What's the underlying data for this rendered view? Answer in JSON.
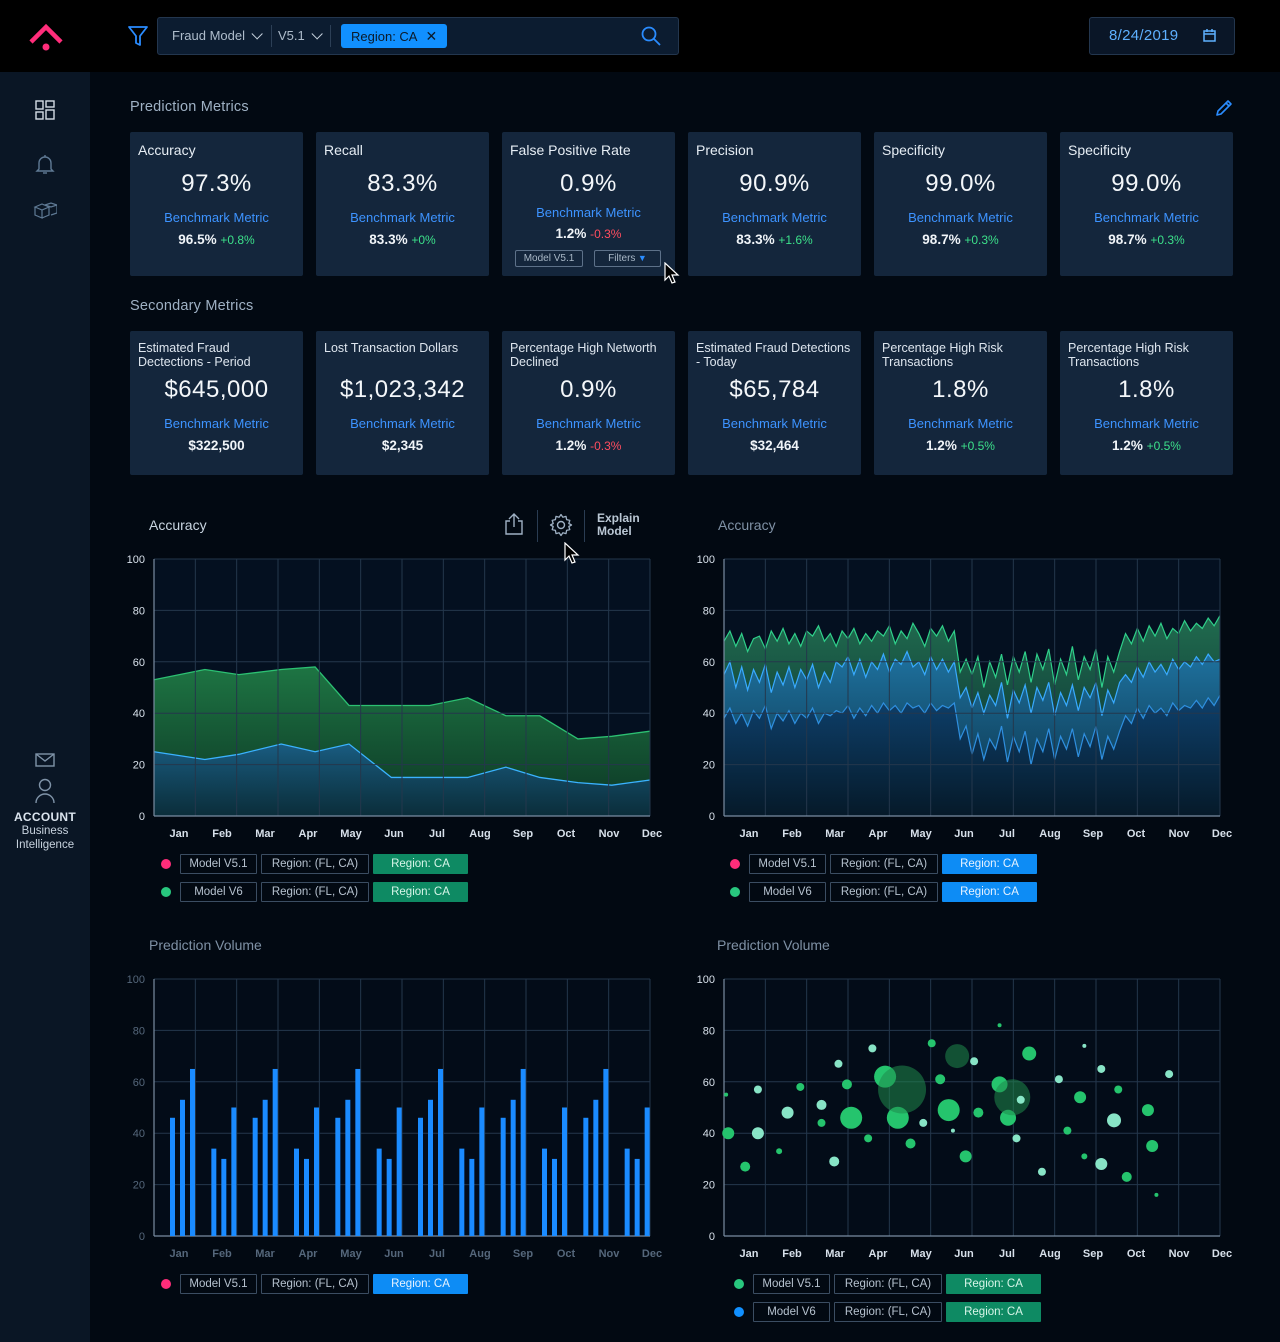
{
  "topbar": {
    "model_select": "Fraud Model",
    "version_select": "V5.1",
    "filter_chip": "Region: CA",
    "date": "8/24/2019"
  },
  "sidebar": {
    "account_label": "ACCOUNT",
    "account_sub1": "Business",
    "account_sub2": "Intelligence"
  },
  "prediction_metrics": {
    "title": "Prediction Metrics",
    "cards": [
      {
        "title": "Accuracy",
        "value": "97.3%",
        "benchmark_label": "Benchmark Metric",
        "benchmark_value": "96.5%",
        "delta": "+0.8%",
        "delta_type": "pos"
      },
      {
        "title": "Recall",
        "value": "83.3%",
        "benchmark_label": "Benchmark Metric",
        "benchmark_value": "83.3%",
        "delta": "+0%",
        "delta_type": "pos"
      },
      {
        "title": "False Positive Rate",
        "value": "0.9%",
        "benchmark_label": "Benchmark Metric",
        "benchmark_value": "1.2%",
        "delta": "-0.3%",
        "delta_type": "neg",
        "model_tag": "Model V5.1",
        "filters_label": "Filters"
      },
      {
        "title": "Precision",
        "value": "90.9%",
        "benchmark_label": "Benchmark Metric",
        "benchmark_value": "83.3%",
        "delta": "+1.6%",
        "delta_type": "pos"
      },
      {
        "title": "Specificity",
        "value": "99.0%",
        "benchmark_label": "Benchmark Metric",
        "benchmark_value": "98.7%",
        "delta": "+0.3%",
        "delta_type": "pos"
      },
      {
        "title": "Specificity",
        "value": "99.0%",
        "benchmark_label": "Benchmark Metric",
        "benchmark_value": "98.7%",
        "delta": "+0.3%",
        "delta_type": "pos"
      }
    ]
  },
  "secondary_metrics": {
    "title": "Secondary Metrics",
    "cards": [
      {
        "title": "Estimated Fraud Dectections - Period",
        "value": "$645,000",
        "benchmark_label": "Benchmark Metric",
        "benchmark_value": "$322,500",
        "delta": "",
        "delta_type": "pos"
      },
      {
        "title": "Lost Transaction Dollars",
        "value": "$1,023,342",
        "benchmark_label": "Benchmark Metric",
        "benchmark_value": "$2,345",
        "delta": "",
        "delta_type": "pos"
      },
      {
        "title": "Percentage High Networth Declined",
        "value": "0.9%",
        "benchmark_label": "Benchmark Metric",
        "benchmark_value": "1.2%",
        "delta": "-0.3%",
        "delta_type": "neg"
      },
      {
        "title": "Estimated Fraud Detections - Today",
        "value": "$65,784",
        "benchmark_label": "Benchmark Metric",
        "benchmark_value": "$32,464",
        "delta": "",
        "delta_type": "pos"
      },
      {
        "title": "Percentage High Risk Transactions",
        "value": "1.8%",
        "benchmark_label": "Benchmark Metric",
        "benchmark_value": "1.2%",
        "delta": "+0.5%",
        "delta_type": "pos"
      },
      {
        "title": "Percentage High Risk Transactions",
        "value": "1.8%",
        "benchmark_label": "Benchmark Metric",
        "benchmark_value": "1.2%",
        "delta": "+0.5%",
        "delta_type": "pos"
      }
    ]
  },
  "toolbar": {
    "explain_line1": "Explain",
    "explain_line2": "Model"
  },
  "legends": {
    "model_v51": "Model V5.1",
    "model_v6": "Model V6",
    "region_fl_ca": "Region: (FL, CA)",
    "region_ca": "Region: CA"
  },
  "colors": {
    "pink": "#ff2d7a",
    "green": "#28c77e",
    "blue": "#1190ff"
  },
  "chart_data": [
    {
      "type": "area",
      "title": "Accuracy",
      "categories": [
        "Jan",
        "Feb",
        "Mar",
        "Apr",
        "May",
        "Jun",
        "Jul",
        "Aug",
        "Sep",
        "Oct",
        "Nov",
        "Dec"
      ],
      "x": [
        0,
        1.2,
        2,
        3,
        3.8,
        4.6,
        5.6,
        6.5,
        7.4,
        8.3,
        9.1,
        10,
        10.8,
        11.7
      ],
      "ylim": [
        0,
        100
      ],
      "yticks": [
        0,
        20,
        40,
        60,
        80,
        100
      ],
      "series": [
        {
          "name": "Model V6",
          "values": [
            53,
            57,
            55,
            57,
            58,
            43,
            43,
            43,
            46,
            39,
            39,
            30,
            31,
            33
          ]
        },
        {
          "name": "Model V5.1",
          "values": [
            25,
            22,
            24,
            28,
            25,
            28,
            15,
            15,
            15,
            19,
            15,
            13,
            12,
            14
          ]
        }
      ]
    },
    {
      "type": "area",
      "title": "Accuracy",
      "categories": [
        "Jan",
        "Feb",
        "Mar",
        "Apr",
        "May",
        "Jun",
        "Jul",
        "Aug",
        "Sep",
        "Oct",
        "Nov",
        "Dec"
      ],
      "ylim": [
        0,
        100
      ],
      "yticks": [
        0,
        20,
        40,
        60,
        80,
        100
      ],
      "series": [
        {
          "name": "Model V6",
          "values": [
            68,
            72,
            66,
            71,
            64,
            69,
            70,
            65,
            72,
            68,
            73,
            67,
            71,
            66,
            72,
            70,
            74,
            68,
            71,
            66,
            72,
            69,
            73,
            67,
            71,
            68,
            72,
            70,
            74,
            67,
            72,
            69,
            75,
            71,
            66,
            73,
            70,
            74,
            68,
            72,
            56,
            61,
            55,
            62,
            50,
            60,
            54,
            63,
            51,
            62,
            56,
            64,
            52,
            63,
            57,
            65,
            51,
            61,
            55,
            66,
            53,
            62,
            57,
            65,
            50,
            62,
            56,
            64,
            71,
            67,
            73,
            68,
            74,
            70,
            75,
            69,
            73,
            71,
            76,
            72,
            75,
            73,
            77,
            74,
            78
          ]
        },
        {
          "name": "Model V5.1",
          "values": [
            55,
            60,
            50,
            58,
            49,
            57,
            52,
            59,
            48,
            56,
            51,
            58,
            50,
            57,
            53,
            59,
            50,
            56,
            52,
            60,
            58,
            62,
            55,
            61,
            54,
            60,
            57,
            63,
            56,
            61,
            59,
            64,
            58,
            60,
            55,
            62,
            57,
            61,
            56,
            60,
            46,
            50,
            42,
            48,
            40,
            47,
            43,
            52,
            38,
            49,
            44,
            51,
            40,
            50,
            45,
            52,
            39,
            48,
            43,
            51,
            41,
            50,
            46,
            52,
            39,
            49,
            44,
            52,
            55,
            52,
            58,
            54,
            60,
            56,
            59,
            55,
            61,
            57,
            60,
            58,
            62,
            59,
            63,
            60,
            61
          ]
        },
        {
          "name": "Region: CA",
          "values": [
            38,
            42,
            36,
            40,
            35,
            41,
            38,
            43,
            34,
            40,
            37,
            41,
            36,
            40,
            38,
            42,
            36,
            40,
            39,
            41,
            40,
            43,
            38,
            42,
            39,
            43,
            40,
            44,
            41,
            43,
            40,
            44,
            42,
            43,
            40,
            44,
            41,
            43,
            42,
            44,
            30,
            35,
            24,
            32,
            22,
            30,
            26,
            35,
            21,
            31,
            25,
            33,
            20,
            30,
            25,
            34,
            22,
            31,
            26,
            34,
            23,
            32,
            27,
            35,
            22,
            31,
            26,
            33,
            39,
            36,
            42,
            38,
            43,
            40,
            42,
            39,
            44,
            41,
            43,
            42,
            45,
            42,
            46,
            43,
            47
          ]
        }
      ]
    },
    {
      "type": "bar",
      "title": "Prediction Volume",
      "categories": [
        "Jan",
        "Feb",
        "Mar",
        "Apr",
        "May",
        "Jun",
        "Jul",
        "Aug",
        "Sep",
        "Oct",
        "Nov",
        "Dec"
      ],
      "ylim": [
        0,
        100
      ],
      "yticks": [
        0,
        20,
        40,
        60,
        80,
        100
      ],
      "series": [
        {
          "name": "Model V5.1",
          "values": [
            46,
            53,
            65,
            34,
            30,
            50,
            46,
            53,
            65,
            34,
            30,
            50,
            46,
            53,
            65,
            34,
            30,
            50,
            46,
            53,
            65,
            34,
            30,
            50,
            46,
            53,
            65,
            34,
            30,
            50,
            46,
            53,
            65,
            34,
            30,
            50
          ]
        }
      ]
    },
    {
      "type": "scatter",
      "title": "Prediction Volume",
      "categories": [
        "Jan",
        "Feb",
        "Mar",
        "Apr",
        "May",
        "Jun",
        "Jul",
        "Aug",
        "Sep",
        "Oct",
        "Nov",
        "Dec"
      ],
      "ylim": [
        0,
        100
      ],
      "yticks": [
        0,
        20,
        40,
        60,
        80,
        100
      ],
      "points": [
        {
          "x": 0.05,
          "y": 55,
          "r": 2,
          "c": "g"
        },
        {
          "x": 0.1,
          "y": 40,
          "r": 6,
          "c": "g"
        },
        {
          "x": 0.5,
          "y": 27,
          "r": 5,
          "c": "g"
        },
        {
          "x": 0.8,
          "y": 57,
          "r": 4,
          "c": "l"
        },
        {
          "x": 0.8,
          "y": 40,
          "r": 6,
          "c": "l"
        },
        {
          "x": 1.3,
          "y": 33,
          "r": 3,
          "c": "g"
        },
        {
          "x": 1.5,
          "y": 48,
          "r": 6,
          "c": "l"
        },
        {
          "x": 1.8,
          "y": 58,
          "r": 4,
          "c": "g"
        },
        {
          "x": 2.3,
          "y": 44,
          "r": 4,
          "c": "g"
        },
        {
          "x": 2.3,
          "y": 51,
          "r": 5,
          "c": "l"
        },
        {
          "x": 2.6,
          "y": 29,
          "r": 5,
          "c": "l"
        },
        {
          "x": 2.7,
          "y": 67,
          "r": 4,
          "c": "l"
        },
        {
          "x": 2.9,
          "y": 59,
          "r": 5,
          "c": "g"
        },
        {
          "x": 3.0,
          "y": 46,
          "r": 11,
          "c": "g"
        },
        {
          "x": 3.4,
          "y": 38,
          "r": 4,
          "c": "g"
        },
        {
          "x": 3.5,
          "y": 73,
          "r": 4,
          "c": "l"
        },
        {
          "x": 3.8,
          "y": 62,
          "r": 11,
          "c": "g"
        },
        {
          "x": 4.1,
          "y": 46,
          "r": 11,
          "c": "g"
        },
        {
          "x": 4.2,
          "y": 57,
          "r": 24,
          "c": "d"
        },
        {
          "x": 4.4,
          "y": 36,
          "r": 5,
          "c": "g"
        },
        {
          "x": 4.7,
          "y": 44,
          "r": 4,
          "c": "l"
        },
        {
          "x": 4.9,
          "y": 75,
          "r": 4,
          "c": "g"
        },
        {
          "x": 5.1,
          "y": 61,
          "r": 5,
          "c": "g"
        },
        {
          "x": 5.3,
          "y": 49,
          "r": 11,
          "c": "g"
        },
        {
          "x": 5.4,
          "y": 41,
          "r": 2,
          "c": "l"
        },
        {
          "x": 5.5,
          "y": 70,
          "r": 12,
          "c": "d"
        },
        {
          "x": 5.7,
          "y": 31,
          "r": 6,
          "c": "g"
        },
        {
          "x": 5.9,
          "y": 68,
          "r": 4,
          "c": "l"
        },
        {
          "x": 6.0,
          "y": 48,
          "r": 5,
          "c": "g"
        },
        {
          "x": 6.5,
          "y": 82,
          "r": 2,
          "c": "g"
        },
        {
          "x": 6.5,
          "y": 59,
          "r": 8,
          "c": "g"
        },
        {
          "x": 6.7,
          "y": 46,
          "r": 8,
          "c": "g"
        },
        {
          "x": 6.8,
          "y": 54,
          "r": 18,
          "c": "d"
        },
        {
          "x": 6.9,
          "y": 38,
          "r": 4,
          "c": "l"
        },
        {
          "x": 7.0,
          "y": 53,
          "r": 4,
          "c": "l"
        },
        {
          "x": 7.2,
          "y": 71,
          "r": 7,
          "c": "g"
        },
        {
          "x": 7.5,
          "y": 25,
          "r": 4,
          "c": "l"
        },
        {
          "x": 7.9,
          "y": 61,
          "r": 4,
          "c": "l"
        },
        {
          "x": 8.1,
          "y": 41,
          "r": 4,
          "c": "g"
        },
        {
          "x": 8.5,
          "y": 31,
          "r": 3,
          "c": "g"
        },
        {
          "x": 8.4,
          "y": 54,
          "r": 6,
          "c": "g"
        },
        {
          "x": 8.5,
          "y": 74,
          "r": 2,
          "c": "l"
        },
        {
          "x": 8.9,
          "y": 65,
          "r": 4,
          "c": "l"
        },
        {
          "x": 8.9,
          "y": 28,
          "r": 6,
          "c": "l"
        },
        {
          "x": 9.2,
          "y": 45,
          "r": 7,
          "c": "l"
        },
        {
          "x": 9.3,
          "y": 57,
          "r": 4,
          "c": "g"
        },
        {
          "x": 9.5,
          "y": 23,
          "r": 5,
          "c": "g"
        },
        {
          "x": 10.0,
          "y": 49,
          "r": 6,
          "c": "g"
        },
        {
          "x": 10.1,
          "y": 35,
          "r": 6,
          "c": "g"
        },
        {
          "x": 10.2,
          "y": 16,
          "r": 2,
          "c": "g"
        },
        {
          "x": 10.5,
          "y": 63,
          "r": 4,
          "c": "l"
        }
      ]
    }
  ]
}
